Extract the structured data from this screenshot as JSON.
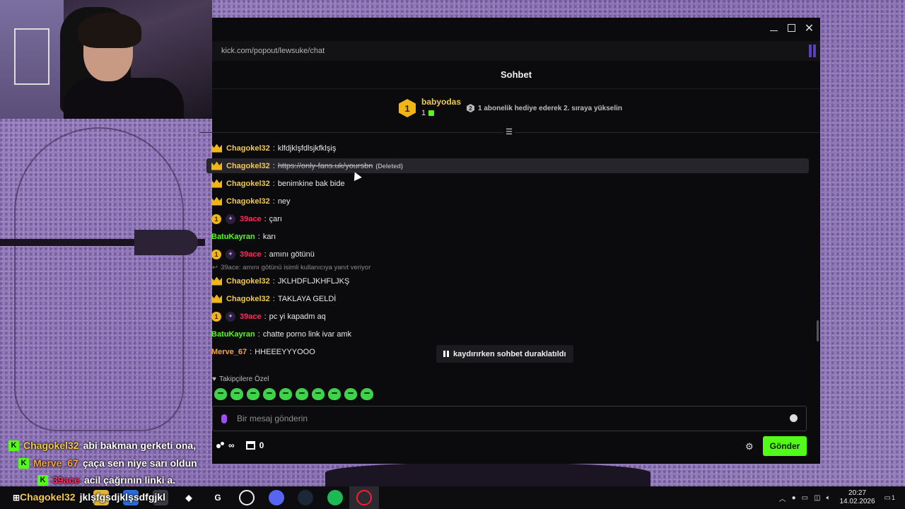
{
  "window": {
    "url": "kick.com/popout/lewsuke/chat",
    "title": "Sohbet"
  },
  "pinned": {
    "rank": "1",
    "username": "babyodas",
    "gift_count": "1",
    "message": "1 abonelik hediye ederek 2. sıraya yükselin",
    "next_rank": "2"
  },
  "messages": [
    {
      "user": "Chagokel32",
      "text": "klfdjklşfdlsjkfklşiş"
    },
    {
      "user": "Chagokel32",
      "link": "https://only-fans.uk/yoursbn",
      "deleted": "(Deleted)"
    },
    {
      "user": "Chagokel32",
      "text": "benimkine bak bide"
    },
    {
      "user": "Chagokel32",
      "text": "ney"
    },
    {
      "user": "39ace",
      "badge": "1",
      "text": "çarı"
    },
    {
      "user": "BatuKayran",
      "text": "karı"
    },
    {
      "user": "39ace",
      "badge": "1",
      "text": "amını götünü"
    },
    {
      "reply": "39ace: amını götünü isimli kullanıcıya yanıt veriyor"
    },
    {
      "user": "Chagokel32",
      "text": "JKLHDFLJKHFLJKŞ"
    },
    {
      "user": "Chagokel32",
      "text": "TAKLAYA GELDİ"
    },
    {
      "user": "39ace",
      "badge": "1",
      "text": "pc yi kapadm aq"
    },
    {
      "user": "BatuKayran",
      "text": "chatte porno link ivar amk"
    },
    {
      "user": "Merve_67",
      "text": "HHEEEYYYOOO"
    }
  ],
  "paused_notice": "kaydırırken sohbet duraklatıldı",
  "followers_only": "Takipçilere Özel",
  "input": {
    "placeholder": "Bir mesaj gönderin"
  },
  "bottom": {
    "infinity": "∞",
    "store_count": "0",
    "send_label": "Gönder"
  },
  "overlay_chat": [
    {
      "user": "Chagokel32",
      "text": "abi bakman gerketi ona,",
      "color": "#f2c94c"
    },
    {
      "user": "Merve_67",
      "text": "çaça sen niye sarı oldun",
      "color": "#f5a340"
    },
    {
      "user": "39ace",
      "text": "acil çağrının linki a.",
      "color": "#ff2b5e"
    },
    {
      "user": "Chagokel32",
      "text": "jklşfgsdjklşsdfgjkl",
      "color": "#f2c94c"
    }
  ],
  "taskbar": {
    "time": "20:27",
    "date": "14.02.2026",
    "notifications": "1"
  },
  "colors": {
    "kick_green": "#53fc18",
    "gold": "#f2c94c",
    "red_user": "#ff2b5e",
    "bg_purple": "#8e76b6"
  }
}
